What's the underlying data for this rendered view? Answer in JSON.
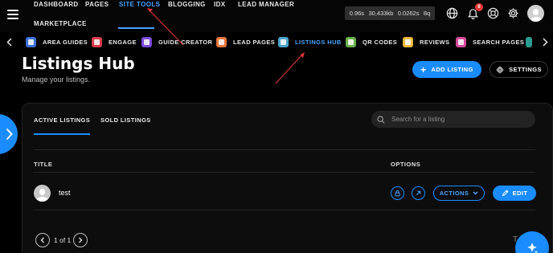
{
  "topnav": {
    "items": [
      {
        "label": "DASHBOARD"
      },
      {
        "label": "PAGES"
      },
      {
        "label": "SITE TOOLS",
        "active": true
      },
      {
        "label": "BLOGGING"
      },
      {
        "label": "IDX"
      },
      {
        "label": "LEAD MANAGER"
      },
      {
        "label": "MARKETPLACE"
      }
    ],
    "perf": [
      "0.96s",
      "30,433kb",
      "0.0262s",
      "8q"
    ],
    "notification_count": "6",
    "icons": [
      "globe-icon",
      "bell-icon",
      "lifebuoy-icon",
      "gear-icon",
      "avatar"
    ]
  },
  "toolbar": {
    "items": [
      {
        "label": "AREA GUIDES",
        "icon_color": "#3b6fd8"
      },
      {
        "label": "ENGAGE",
        "icon_color": "#d83b4a"
      },
      {
        "label": "GUIDE CREATOR",
        "icon_color": "#7b4ad8"
      },
      {
        "label": "LEAD PAGES",
        "icon_color": "#e8743b"
      },
      {
        "label": "LISTINGS HUB",
        "icon_color": "#4aa3c8",
        "active": true
      },
      {
        "label": "QR CODES",
        "icon_color": "#6ab04c"
      },
      {
        "label": "REVIEWS",
        "icon_color": "#e8b93b"
      },
      {
        "label": "SEARCH PAGES",
        "icon_color": "#d84a9b"
      }
    ]
  },
  "page": {
    "title": "Listings Hub",
    "subtitle": "Manage your listings.",
    "add_button": "ADD LISTING",
    "settings_button": "SETTINGS"
  },
  "tabs": [
    {
      "label": "ACTIVE LISTINGS",
      "active": true
    },
    {
      "label": "SOLD LISTINGS"
    }
  ],
  "search": {
    "placeholder": "Search for a listing"
  },
  "table": {
    "columns": [
      "TITLE",
      "OPTIONS"
    ],
    "rows": [
      {
        "title": "test",
        "actions_label": "ACTIONS",
        "edit_label": "EDIT"
      }
    ]
  },
  "pagination": {
    "text": "1 of 1"
  },
  "colors": {
    "accent": "#1a8cff",
    "accent_text": "#4aa3ff",
    "background": "#000000",
    "badge": "#e53935"
  }
}
